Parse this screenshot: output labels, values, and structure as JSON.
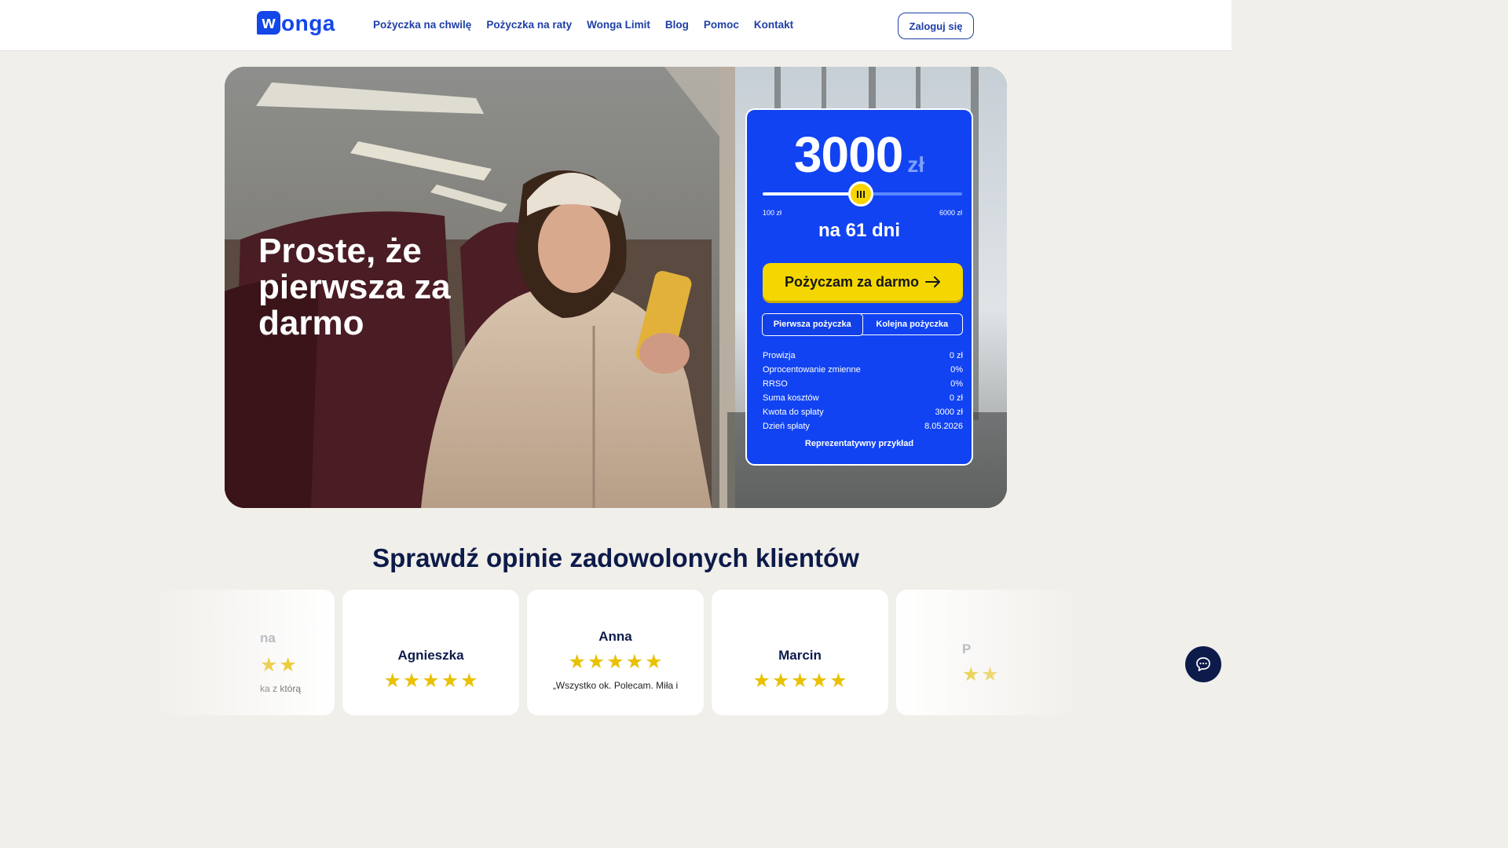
{
  "header": {
    "logo_mark": "w",
    "logo_text": "onga",
    "nav": [
      "Pożyczka na chwilę",
      "Pożyczka na raty",
      "Wonga Limit",
      "Blog",
      "Pomoc",
      "Kontakt"
    ],
    "login_label": "Zaloguj się"
  },
  "hero": {
    "title": "Proste, że pierwsza za darmo"
  },
  "calculator": {
    "amount": "3000",
    "currency": "zł",
    "slider_value": 3000,
    "slider_min_value": 100,
    "slider_max_value": 6000,
    "slider_min_label": "100 zł",
    "slider_max_label": "6000 zł",
    "days_label": "na 61 dni",
    "cta_label": "Pożyczam za darmo",
    "cta_icon": "arrow-right-icon",
    "tabs": [
      "Pierwsza pożyczka",
      "Kolejna pożyczka"
    ],
    "active_tab": "Pierwsza pożyczka",
    "costs": [
      {
        "label": "Prowizja",
        "value": "0 zł"
      },
      {
        "label": "Oprocentowanie zmienne",
        "value": "0%"
      },
      {
        "label": "RRSO",
        "value": "0%"
      },
      {
        "label": "Suma kosztów",
        "value": "0 zł"
      },
      {
        "label": "Kwota do spłaty",
        "value": "3000 zł"
      },
      {
        "label": "Dzień spłaty",
        "value": "8.05.2026"
      }
    ],
    "representative": "Reprezentatywny przykład"
  },
  "reviews": {
    "title": "Sprawdź opinie zadowolonych klientów",
    "cards": [
      {
        "name": "na",
        "quote": "ka z którą",
        "rating": 5
      },
      {
        "name": "Agnieszka",
        "quote": "",
        "rating": 5
      },
      {
        "name": "Anna",
        "quote": "„Wszystko ok. Polecam. Miła i",
        "rating": 5
      },
      {
        "name": "Marcin",
        "quote": "",
        "rating": 5
      },
      {
        "name": "P",
        "quote": "",
        "rating": 5
      }
    ]
  },
  "chat": {
    "icon": "chat-icon"
  },
  "colors": {
    "brand_blue": "#1143f2",
    "navy": "#0d1b4a",
    "cta_yellow": "#f4d600",
    "star_gold": "#e9c100",
    "page_bg": "#f1efea"
  }
}
